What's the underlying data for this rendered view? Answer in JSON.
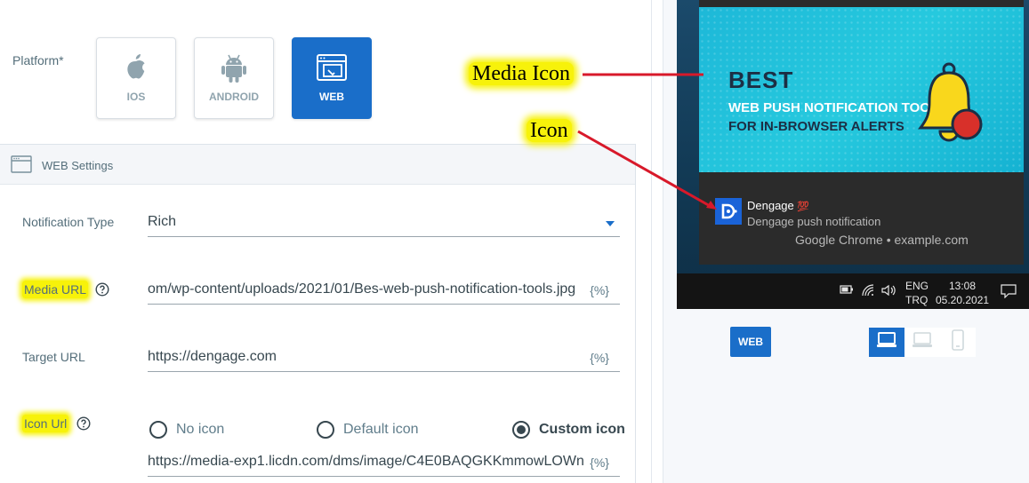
{
  "platform": {
    "label": "Platform*",
    "options": [
      {
        "label": "IOS",
        "icon": "apple-icon"
      },
      {
        "label": "ANDROID",
        "icon": "android-icon"
      },
      {
        "label": "WEB",
        "icon": "browser-window-icon",
        "selected": true
      }
    ]
  },
  "web_settings": {
    "title": "WEB Settings",
    "icon": "browser-window-icon",
    "notification_type": {
      "label": "Notification Type",
      "value": "Rich"
    },
    "media_url": {
      "label": "Media URL",
      "value": "om/wp-content/uploads/2021/01/Bes-web-push-notification-tools.jpg",
      "variable": "{%}"
    },
    "target_url": {
      "label": "Target URL",
      "value": "https://dengage.com",
      "variable": "{%}"
    },
    "icon_url": {
      "label": "Icon Url",
      "options": [
        {
          "label": "No icon",
          "selected": false
        },
        {
          "label": "Default icon",
          "selected": false
        },
        {
          "label": "Custom icon",
          "selected": true
        }
      ],
      "value": "https://media-exp1.licdn.com/dms/image/C4E0BAQGKKmmowLOWn",
      "variable": "{%}"
    }
  },
  "preview": {
    "banner": {
      "headline": "BEST",
      "line1": "WEB PUSH NOTIFICATION TOOLS",
      "line2": "FOR IN-BROWSER ALERTS"
    },
    "notification": {
      "title": "Dengage",
      "title_emoji": "💯",
      "body": "Dengage push notification",
      "source": "Google Chrome • example.com"
    },
    "taskbar": {
      "lang1": "ENG",
      "lang2": "TRQ",
      "time": "13:08",
      "date": "05.20.2021"
    },
    "platform_badge": "WEB",
    "devices": [
      "desktop-icon",
      "laptop-icon",
      "mobile-icon"
    ]
  },
  "annotations": {
    "media_icon": "Media Icon",
    "icon": "Icon"
  },
  "colors": {
    "accent": "#1a6ec9",
    "highlight": "#f7f20a",
    "arrow": "#d8192a"
  }
}
